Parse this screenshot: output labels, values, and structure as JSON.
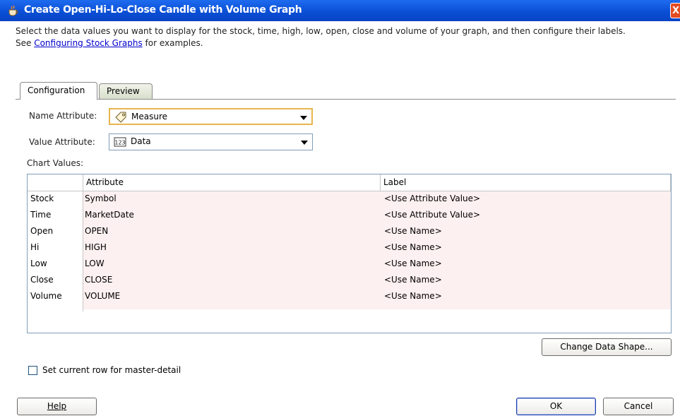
{
  "window": {
    "title": "Create Open-Hi-Lo-Close Candle with Volume Graph",
    "close_glyph": "X",
    "accent_color": "#0a4fd6"
  },
  "instructions": {
    "line1": "Select the data values you want to display for the stock, time, high, low, open, close and volume of your graph, and then configure their labels.",
    "line2_prefix": "See ",
    "link_text": "Configuring Stock Graphs",
    "line2_suffix": " for examples."
  },
  "tabs": [
    {
      "label": "Configuration",
      "selected": true
    },
    {
      "label": "Preview",
      "selected": false
    }
  ],
  "name_attribute": {
    "label": "Name Attribute:",
    "value": "Measure",
    "icon": "tag-icon"
  },
  "value_attribute": {
    "label": "Value Attribute:",
    "value": "Data",
    "icon": "numeric-icon",
    "icon_text": "123"
  },
  "chart_values": {
    "label": "Chart Values:",
    "columns": [
      "Attribute",
      "Label"
    ],
    "rows": [
      {
        "name": "Stock",
        "attribute": "Symbol",
        "label": "<Use Attribute Value>"
      },
      {
        "name": "Time",
        "attribute": "MarketDate",
        "label": "<Use Attribute Value>"
      },
      {
        "name": "Open",
        "attribute": "OPEN",
        "label": "<Use Name>"
      },
      {
        "name": "Hi",
        "attribute": "HIGH",
        "label": "<Use Name>"
      },
      {
        "name": "Low",
        "attribute": "LOW",
        "label": "<Use Name>"
      },
      {
        "name": "Close",
        "attribute": "CLOSE",
        "label": "<Use Name>"
      },
      {
        "name": "Volume",
        "attribute": "VOLUME",
        "label": "<Use Name>"
      }
    ]
  },
  "change_data_shape_label": "Change Data Shape...",
  "master_detail": {
    "label": "Set current row for master-detail",
    "checked": false
  },
  "buttons": {
    "help": "Help",
    "ok": "OK",
    "cancel": "Cancel"
  }
}
